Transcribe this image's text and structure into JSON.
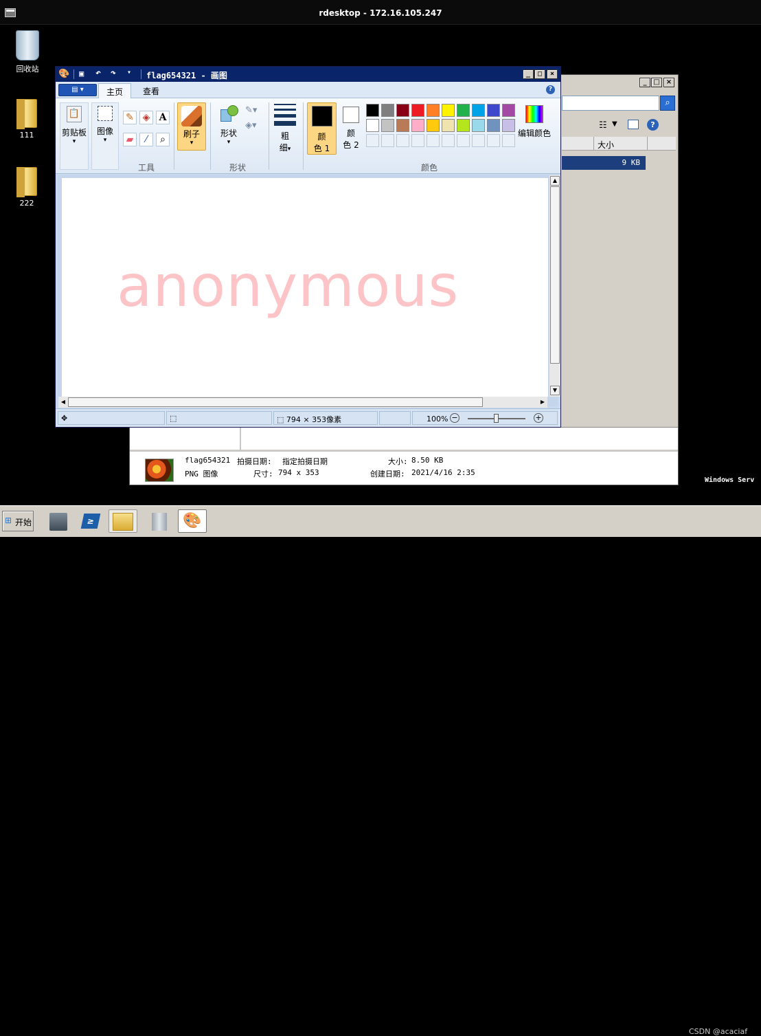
{
  "rdesktop": {
    "title": "rdesktop - 172.16.105.247"
  },
  "desktop": {
    "icons": [
      {
        "label": "回收站",
        "icon": "recycle-bin-icon"
      },
      {
        "label": "111",
        "icon": "folder-icon"
      },
      {
        "label": "222",
        "icon": "folder-icon"
      }
    ],
    "server_text": "Windows Serv"
  },
  "explorer": {
    "column_header": "大小",
    "row_size": "9 KB",
    "details": {
      "name": "flag654321",
      "date_taken_label": "拍摄日期:",
      "date_taken": "指定拍摄日期",
      "type": "PNG 图像",
      "dimensions_label": "尺寸:",
      "dimensions": "794 x 353",
      "size_label": "大小:",
      "size": "8.50 KB",
      "created_label": "创建日期:",
      "created": "2021/4/16 2:35"
    }
  },
  "paint": {
    "title": "flag654321 - 画图",
    "tabs": [
      "主页",
      "查看"
    ],
    "ribbon": {
      "clipboard": "剪贴板",
      "image": "图像",
      "tools_group": "工具",
      "brush": "刷子",
      "shapes": "形状",
      "shapes_group": "形状",
      "size_top": "粗",
      "size_bottom": "细",
      "color1_top": "颜",
      "color1_bottom": "色 1",
      "color2_top": "颜",
      "color2_bottom": "色 2",
      "edit_colors": "编辑颜色",
      "colors_group": "颜色"
    },
    "palette_row1": [
      "#000000",
      "#7f7f7f",
      "#880015",
      "#ed1c24",
      "#ff7f27",
      "#fff200",
      "#22b14c",
      "#00a2e8",
      "#3f48cc",
      "#a349a4"
    ],
    "palette_row2": [
      "#ffffff",
      "#c3c3c3",
      "#b97a57",
      "#ffaec9",
      "#ffc90e",
      "#efe4b0",
      "#b5e61d",
      "#99d9ea",
      "#7092be",
      "#c8bfe7"
    ],
    "canvas_text": "anonymous",
    "status": {
      "dimensions": "794 × 353像素",
      "zoom": "100%"
    }
  },
  "taskbar": {
    "start": "开始"
  },
  "watermark": "CSDN @acaciaf"
}
